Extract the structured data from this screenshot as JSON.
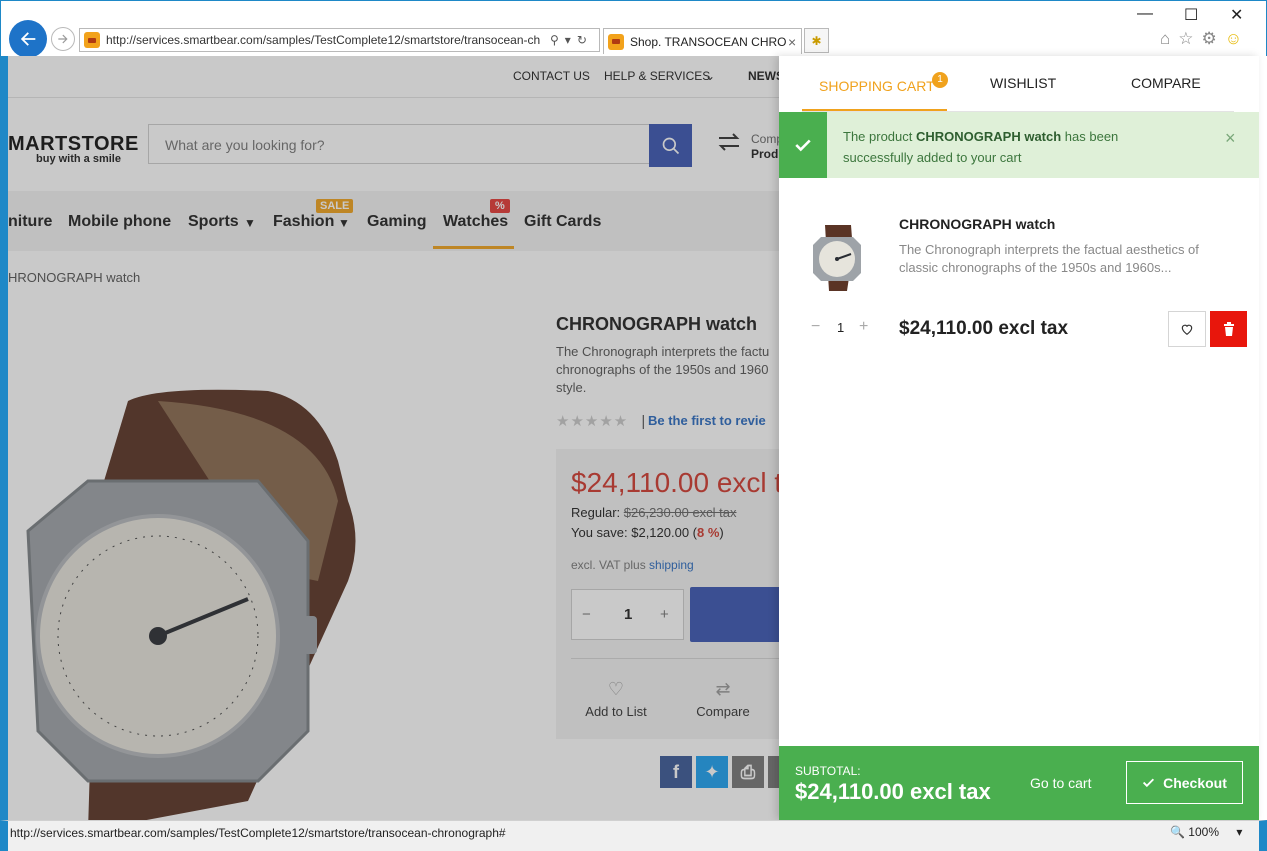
{
  "browser": {
    "url": "http://services.smartbear.com/samples/TestComplete12/smartstore/transocean-ch",
    "tab_title": "Shop. TRANSOCEAN CHRO...",
    "status_url": "http://services.smartbear.com/samples/TestComplete12/smartstore/transocean-chronograph#",
    "zoom": "100%"
  },
  "site": {
    "topnav": [
      "CONTACT US",
      "HELP & SERVICES",
      "NEWS"
    ],
    "logo_main": "MARTSTORE",
    "logo_sub": "buy with a smile",
    "search_placeholder": "What are you looking for?",
    "compare_label": "Comp",
    "compare_sub": "Prod",
    "categories": [
      "niture",
      "Mobile phone",
      "Sports",
      "Fashion",
      "Gaming",
      "Watches",
      "Gift Cards"
    ],
    "badge_sale": "SALE",
    "badge_pct": "%",
    "breadcrumb": "HRONOGRAPH watch"
  },
  "product": {
    "title": "CHRONOGRAPH watch",
    "desc": "The Chronograph interprets the factu chronographs of the 1950s and 1960 style.",
    "review_link": "Be the first to revie",
    "price": "$24,110.00 excl t",
    "regular_label": "Regular:",
    "regular_value": "$26,230.00 excl tax",
    "save_label": "You save: $2,120.00 (",
    "save_pct": "8 %",
    "save_close": ")",
    "vat_text": "excl. VAT plus ",
    "vat_link": "shipping",
    "qty": "1",
    "add_to_list": "Add to List",
    "compare": "Compare"
  },
  "panel": {
    "tabs": [
      "SHOPPING CART",
      "WISHLIST",
      "COMPARE"
    ],
    "cart_count": "1",
    "notice_pre": "The product ",
    "notice_product": "CHRONOGRAPH watch",
    "notice_post": " has been successfully added to your cart",
    "item": {
      "name": "CHRONOGRAPH watch",
      "desc": "The Chronograph interprets the factual aesthetics of classic chronographs of the 1950s and 1960s...",
      "qty": "1",
      "price": "$24,110.00 excl tax"
    },
    "subtotal_label": "SUBTOTAL:",
    "subtotal_value": "$24,110.00 excl tax",
    "go_to_cart": "Go to cart",
    "checkout": "Checkout"
  },
  "colors": {
    "accent_orange": "#f0a21d",
    "success_green": "#4aaf4f",
    "danger_red": "#e8160c",
    "brand_blue": "#3b57b3"
  }
}
